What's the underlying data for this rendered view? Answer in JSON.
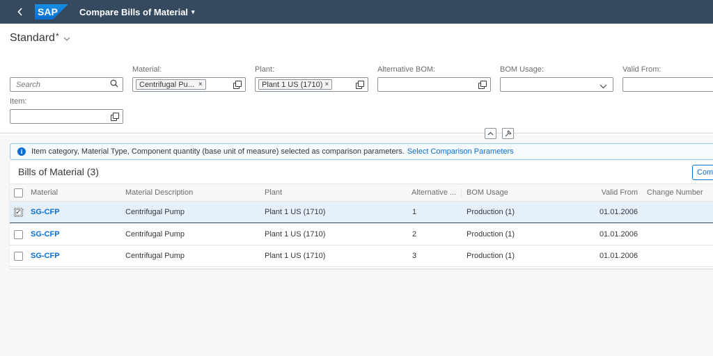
{
  "shell": {
    "back_label": "‹",
    "logo_text": "SAP",
    "app_title": "Compare Bills of Material",
    "title_caret": "▾",
    "colors": {
      "shell_bg": "#354a5f",
      "logo_blue": "#0a6ed1"
    }
  },
  "variant": {
    "name": "Standard",
    "modified_marker": "*",
    "chevron": "⌵"
  },
  "filters": {
    "search": {
      "placeholder": "Search",
      "value": ""
    },
    "material": {
      "label": "Material:",
      "token": "Centrifugal Pu...",
      "token_remove": "×"
    },
    "plant": {
      "label": "Plant:",
      "token": "Plant 1 US (1710)",
      "token_remove": "×"
    },
    "alternative_bom": {
      "label": "Alternative BOM:",
      "value": ""
    },
    "bom_usage": {
      "label": "BOM Usage:",
      "value": "",
      "dropdown_icon": "⌵"
    },
    "valid_from": {
      "label": "Valid From:",
      "value": ""
    },
    "item": {
      "label": "Item:",
      "value": ""
    }
  },
  "header_controls": {
    "collapse_icon": "^",
    "pin_icon": "📌"
  },
  "message_strip": {
    "icon": "i",
    "text": "Item category, Material Type, Component quantity (base unit of measure) selected as comparison parameters.",
    "link": "Select Comparison Parameters"
  },
  "table": {
    "title": "Bills of Material (3)",
    "compare_button": "Compare",
    "columns": [
      "Material",
      "Material Description",
      "Plant",
      "Alternative ...",
      "BOM Usage",
      "Valid From",
      "Change Number"
    ],
    "rows": [
      {
        "selected": true,
        "material": "SG-CFP",
        "description": "Centrifugal Pump",
        "plant": "Plant 1 US (1710)",
        "alternative": "1",
        "bom_usage": "Production (1)",
        "valid_from": "01.01.2006",
        "change_number": ""
      },
      {
        "selected": false,
        "material": "SG-CFP",
        "description": "Centrifugal Pump",
        "plant": "Plant 1 US (1710)",
        "alternative": "2",
        "bom_usage": "Production (1)",
        "valid_from": "01.01.2006",
        "change_number": ""
      },
      {
        "selected": false,
        "material": "SG-CFP",
        "description": "Centrifugal Pump",
        "plant": "Plant 1 US (1710)",
        "alternative": "3",
        "bom_usage": "Production (1)",
        "valid_from": "01.01.2006",
        "change_number": ""
      }
    ],
    "check_mark": "✓"
  }
}
